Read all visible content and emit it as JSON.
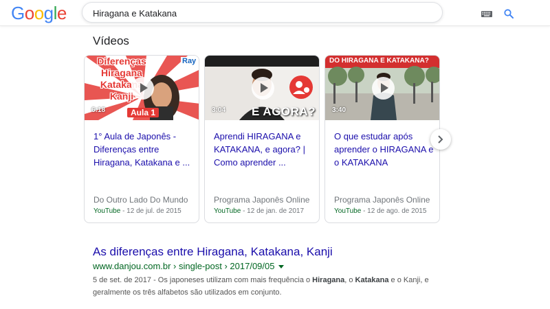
{
  "logo": [
    "G",
    "o",
    "o",
    "g",
    "l",
    "e"
  ],
  "search": {
    "query": "Hiragana e Katakana"
  },
  "videos_section": {
    "title": "Vídeos"
  },
  "videos": [
    {
      "overlay_lines": [
        "Diferenças",
        "Hiragana",
        "Katakana",
        "Kanji"
      ],
      "badge": "Ray",
      "tag": "Aula 1",
      "duration": "6:18",
      "title": "1° Aula de Japonês - Diferenças entre Hiragana, Katakana e ...",
      "channel": "Do Outro Lado Do Mundo",
      "source": "YouTube",
      "date": " - 12 de jul. de 2015"
    },
    {
      "overlay_text": "E AGORA?",
      "duration": "3:04",
      "title": "Aprendi HIRAGANA e KATAKANA, e agora? | Como aprender ...",
      "channel": "Programa Japonês Online",
      "source": "YouTube",
      "date": " - 12 de jan. de 2017"
    },
    {
      "overlay_text": "DO HIRAGANA E KATAKANA?",
      "duration": "3:40",
      "title": "O que estudar após aprender o HIRAGANA e o KATAKANA",
      "channel": "Programa Japonês Online",
      "source": "YouTube",
      "date": " - 12 de ago. de 2015"
    }
  ],
  "result": {
    "title": "As diferenças entre Hiragana, Katakana, Kanji",
    "url": "www.danjou.com.br › single-post › 2017/09/05",
    "snippet": {
      "date": "5 de set. de 2017",
      "sep": " - Os japoneses utilizam com mais frequência o ",
      "kw1": "Hiragana",
      "mid": ", o ",
      "kw2": "Katakana",
      "tail": " e o Kanji, e geralmente os três alfabetos são utilizados em conjunto."
    }
  },
  "colors": {
    "link": "#1a0dab",
    "url": "#006621",
    "meta": "#70757a"
  }
}
